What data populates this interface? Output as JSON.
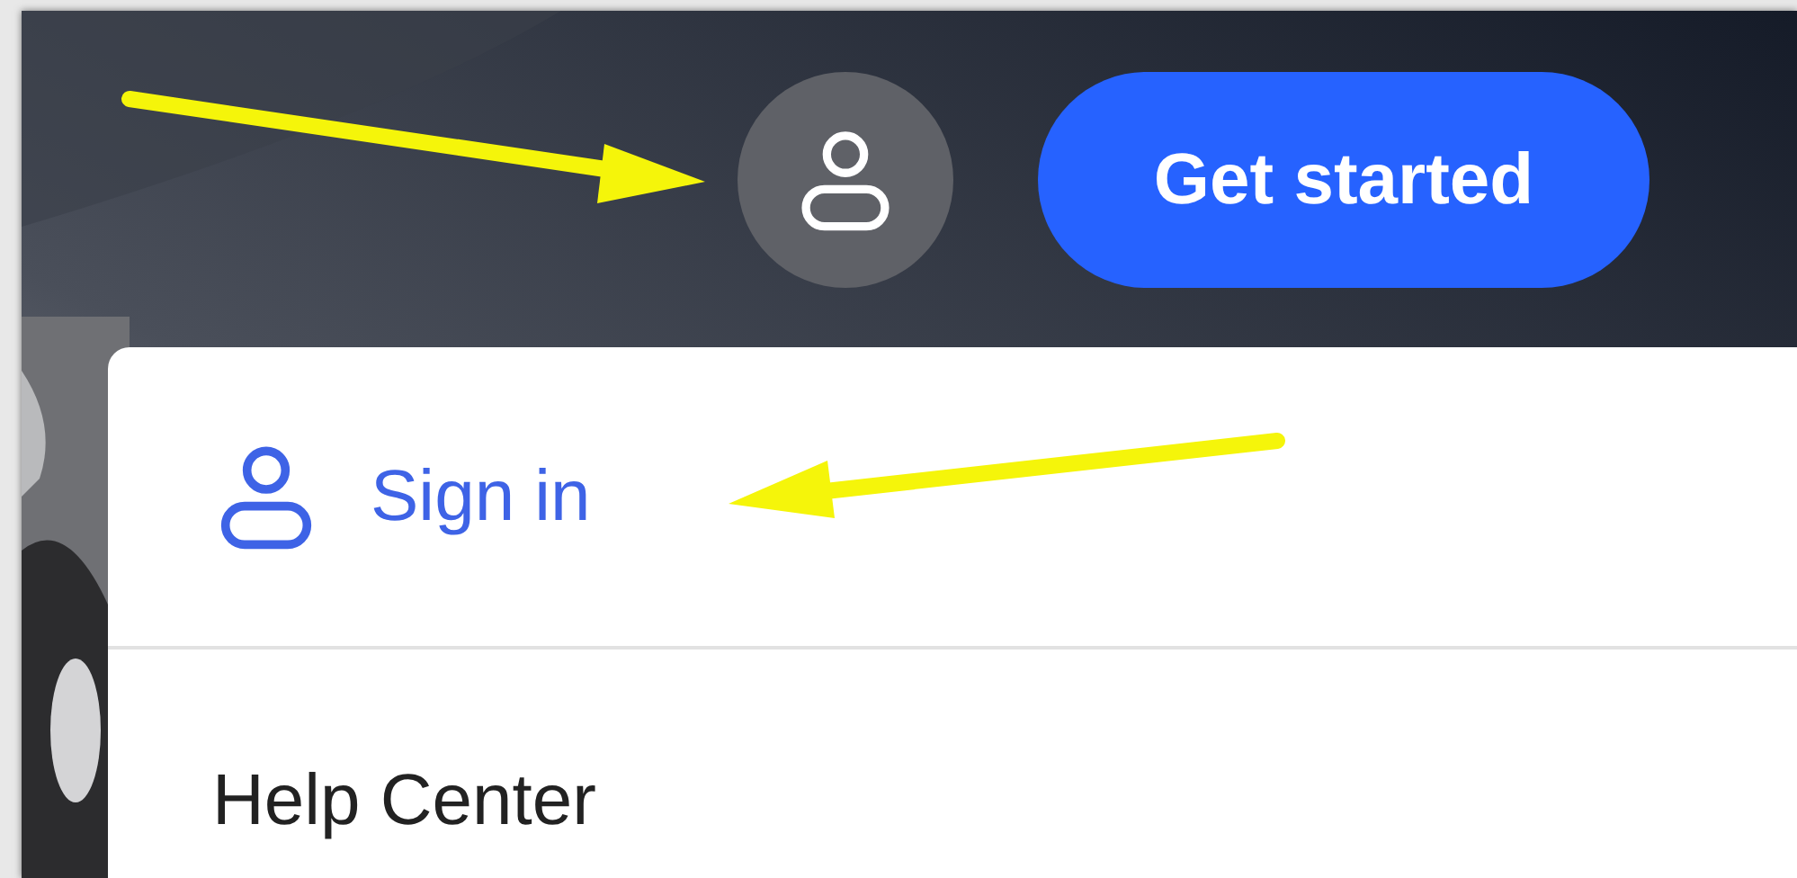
{
  "header": {
    "account_button": {
      "kind": "account"
    },
    "cta_button": {
      "label": "Get started"
    }
  },
  "menu": {
    "items": [
      {
        "kind": "account",
        "label": "Sign in"
      },
      {
        "kind": "plain",
        "label": "Help Center"
      }
    ]
  }
}
